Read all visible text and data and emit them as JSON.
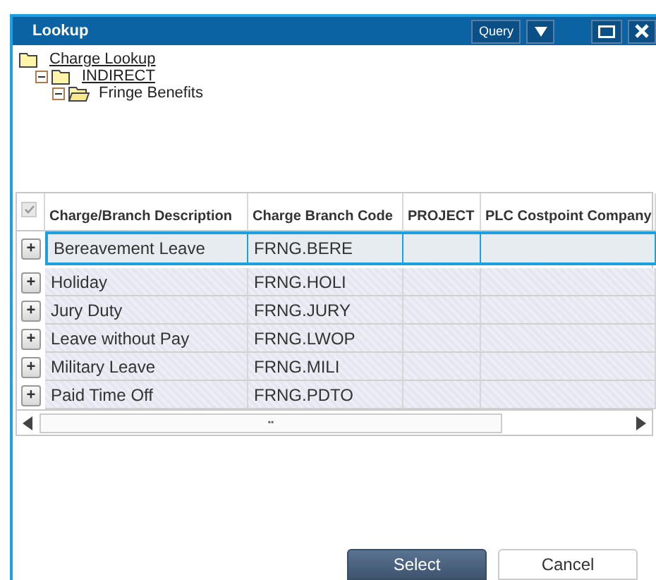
{
  "window": {
    "title": "Lookup",
    "query_button": "Query"
  },
  "tree": [
    {
      "label": "Charge Lookup",
      "current": false,
      "children": [
        {
          "label": "INDIRECT",
          "expanded": true,
          "current": false,
          "children": [
            {
              "label": "Fringe Benefits",
              "expanded": true,
              "current": true
            }
          ]
        }
      ]
    }
  ],
  "table": {
    "select_all_checked": true,
    "columns": [
      "Charge/Branch Description",
      "Charge Branch Code",
      "PROJECT",
      "PLC Costpoint Company"
    ],
    "rows": [
      {
        "selected": true,
        "cells": [
          "Bereavement Leave",
          "FRNG.BERE",
          "",
          ""
        ]
      },
      {
        "selected": false,
        "cells": [
          "Holiday",
          "FRNG.HOLI",
          "",
          ""
        ]
      },
      {
        "selected": false,
        "cells": [
          "Jury Duty",
          "FRNG.JURY",
          "",
          ""
        ]
      },
      {
        "selected": false,
        "cells": [
          "Leave without Pay",
          "FRNG.LWOP",
          "",
          ""
        ]
      },
      {
        "selected": false,
        "cells": [
          "Military Leave",
          "FRNG.MILI",
          "",
          ""
        ]
      },
      {
        "selected": false,
        "cells": [
          "Paid Time Off",
          "FRNG.PDTO",
          "",
          ""
        ]
      }
    ],
    "expand_symbol": "+",
    "scroll_thumb_mark": "▪▪"
  },
  "buttons": [
    {
      "label": "Select",
      "kind": "primary"
    },
    {
      "label": "Cancel",
      "kind": "secondary"
    }
  ]
}
